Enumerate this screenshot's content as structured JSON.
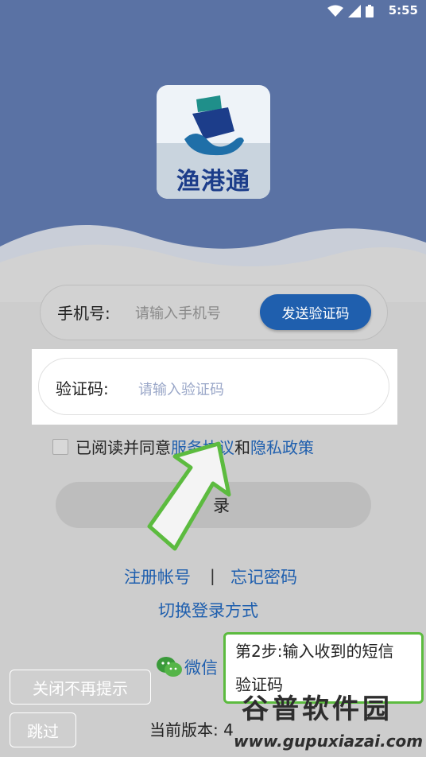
{
  "status_bar": {
    "time": "5:55"
  },
  "logo": {
    "text": "渔港通"
  },
  "form": {
    "phone_label": "手机号:",
    "phone_placeholder": "请输入手机号",
    "send_code_label": "发送验证码",
    "code_label": "验证码:",
    "code_placeholder": "请输入验证码"
  },
  "agreement": {
    "prefix": "已阅读并同意",
    "service_link": "服务协议",
    "and": "和",
    "privacy_link": "隐私政策"
  },
  "login": {
    "label": "录"
  },
  "links": {
    "register": "注册帐号",
    "separator": "|",
    "forgot": "忘记密码",
    "switch": "切换登录方式",
    "wechat": "微信"
  },
  "overlay": {
    "tip_line1": "第2步:输入收到的短信",
    "tip_line2": "验证码",
    "close_forever": "关闭不再提示",
    "skip": "跳过"
  },
  "version": {
    "label": "当前版本: 4"
  },
  "watermark": {
    "brand": "谷普软件园",
    "url": "www.gupuxiazai.com"
  },
  "colors": {
    "hero": "#5a72a4",
    "accent": "#1f5fae",
    "tip_border": "#5cbb3f"
  }
}
